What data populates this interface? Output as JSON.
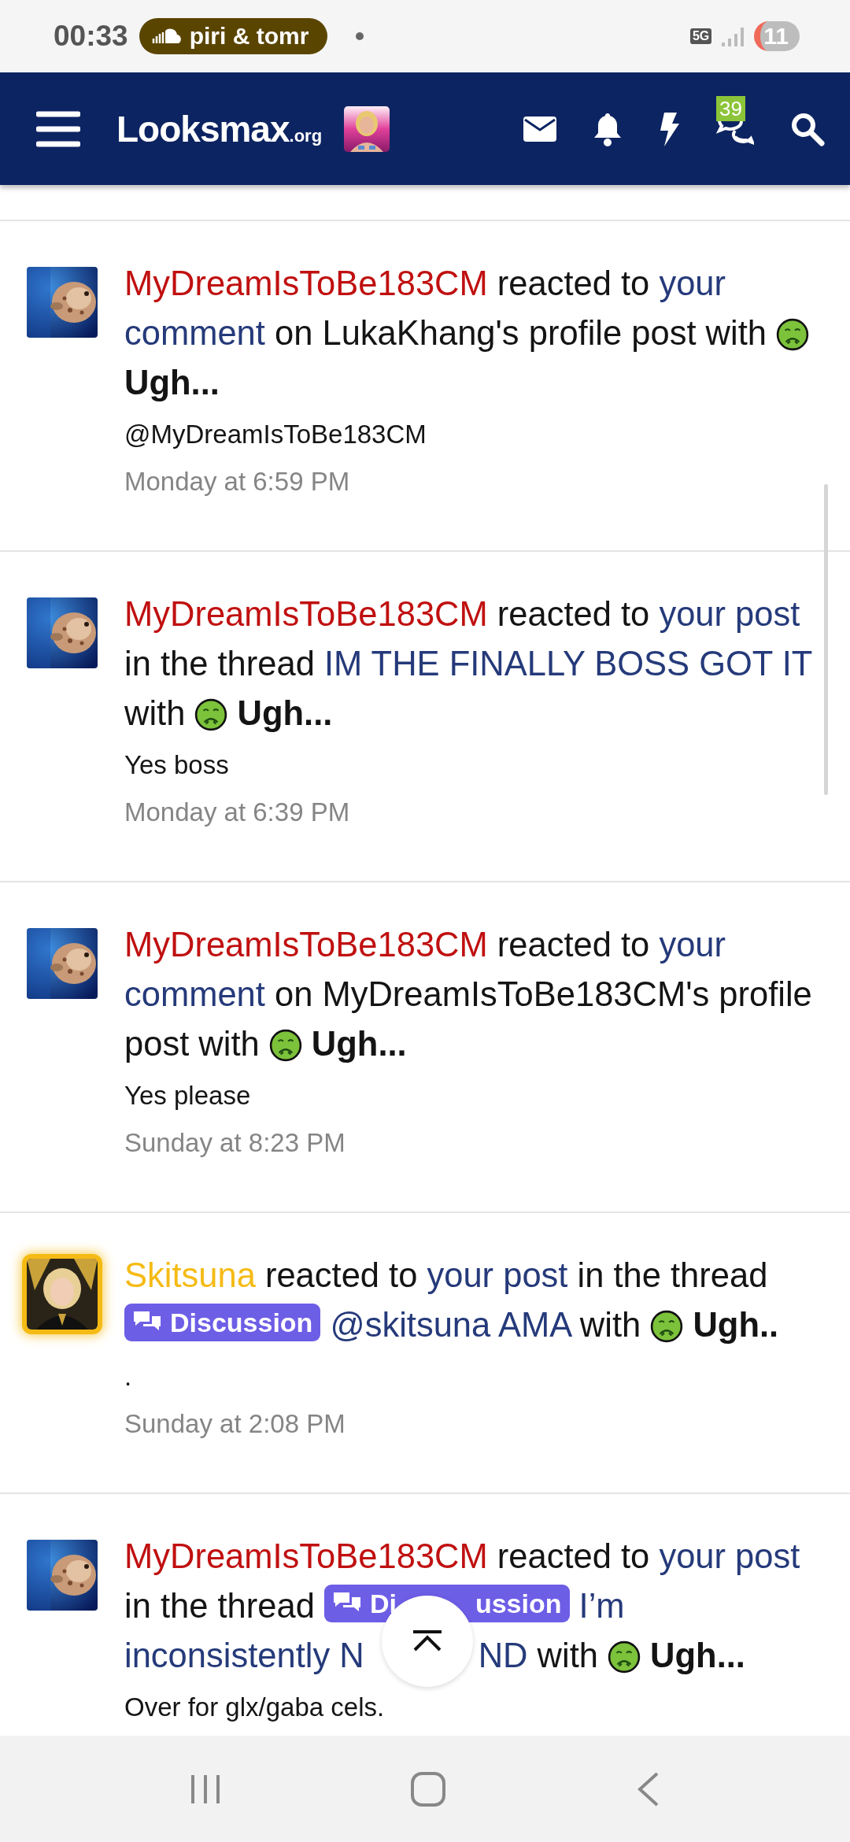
{
  "status_bar": {
    "time": "00:33",
    "media": "piri & tomr",
    "network": "5G",
    "battery": "11"
  },
  "header": {
    "logo": "Looksmax",
    "logo_suffix": ".org",
    "chat_badge": "39"
  },
  "notifications": [
    {
      "glow": false,
      "segments": [
        {
          "kind": "user",
          "text": "MyDreamIsToBe183CM",
          "color": "#c01010"
        },
        {
          "kind": "text",
          "text": " reacted to "
        },
        {
          "kind": "link",
          "text": "your"
        },
        {
          "kind": "space"
        },
        {
          "kind": "link",
          "text": "comment"
        },
        {
          "kind": "text",
          "text": " on LukaKhang's profile post with "
        },
        {
          "kind": "reaction",
          "text": "Ugh..."
        }
      ],
      "snippet": "@MyDreamIsToBe183CM",
      "time": "Monday at 6:59 PM"
    },
    {
      "glow": false,
      "segments": [
        {
          "kind": "user",
          "text": "MyDreamIsToBe183CM",
          "color": "#c01010"
        },
        {
          "kind": "text",
          "text": " reacted to "
        },
        {
          "kind": "link",
          "text": "your post"
        },
        {
          "kind": "text",
          "text": " in the thread "
        },
        {
          "kind": "link",
          "text": "IM THE FINALLY BOSS GOT IT"
        },
        {
          "kind": "text",
          "text": " with "
        },
        {
          "kind": "reaction",
          "text": "Ugh..."
        }
      ],
      "snippet": "Yes boss",
      "time": "Monday at 6:39 PM"
    },
    {
      "glow": false,
      "segments": [
        {
          "kind": "user",
          "text": "MyDreamIsToBe183CM",
          "color": "#c01010"
        },
        {
          "kind": "text",
          "text": " reacted to "
        },
        {
          "kind": "link",
          "text": "your"
        },
        {
          "kind": "space"
        },
        {
          "kind": "link",
          "text": "comment"
        },
        {
          "kind": "text",
          "text": " on MyDreamIsToBe183CM's profile post with "
        },
        {
          "kind": "reaction",
          "text": "Ugh..."
        }
      ],
      "snippet": "Yes please",
      "time": "Sunday at 8:23 PM"
    },
    {
      "glow": true,
      "segments": [
        {
          "kind": "user",
          "text": "Skitsuna",
          "color": "#f5bb14"
        },
        {
          "kind": "text",
          "text": " reacted to "
        },
        {
          "kind": "link",
          "text": "your post"
        },
        {
          "kind": "text",
          "text": " in the thread "
        },
        {
          "kind": "label",
          "text": "Discussion"
        },
        {
          "kind": "space"
        },
        {
          "kind": "link",
          "text": "@skitsuna AMA"
        },
        {
          "kind": "text",
          "text": " with "
        },
        {
          "kind": "reaction",
          "text": "Ugh.."
        }
      ],
      "snippet": ".",
      "time": "Sunday at 2:08 PM"
    },
    {
      "glow": false,
      "segments": [
        {
          "kind": "user",
          "text": "MyDreamIsToBe183CM",
          "color": "#c01010"
        },
        {
          "kind": "text",
          "text": " reacted to "
        },
        {
          "kind": "link",
          "text": "your post"
        },
        {
          "kind": "text",
          "text": " in the thread "
        },
        {
          "kind": "label",
          "text": "Di",
          "text_after": "ussion"
        },
        {
          "kind": "space"
        },
        {
          "kind": "link",
          "text": "I’m"
        },
        {
          "kind": "space"
        },
        {
          "kind": "link",
          "text": "inconsistently N"
        },
        {
          "kind": "gap"
        },
        {
          "kind": "link",
          "text": "ND"
        },
        {
          "kind": "text",
          "text": " with "
        },
        {
          "kind": "reaction",
          "text": "Ugh..."
        }
      ],
      "snippet": "Over for glx/gaba cels."
    }
  ]
}
